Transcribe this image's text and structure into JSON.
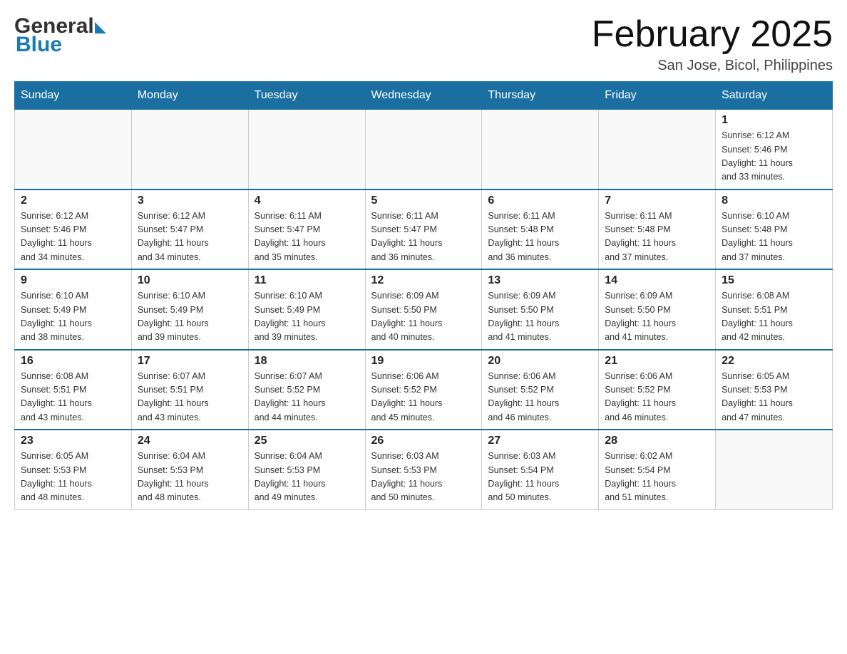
{
  "header": {
    "logo_general": "General",
    "logo_blue": "Blue",
    "month_title": "February 2025",
    "location": "San Jose, Bicol, Philippines"
  },
  "days_of_week": [
    "Sunday",
    "Monday",
    "Tuesday",
    "Wednesday",
    "Thursday",
    "Friday",
    "Saturday"
  ],
  "weeks": [
    {
      "days": [
        {
          "date": "",
          "info": ""
        },
        {
          "date": "",
          "info": ""
        },
        {
          "date": "",
          "info": ""
        },
        {
          "date": "",
          "info": ""
        },
        {
          "date": "",
          "info": ""
        },
        {
          "date": "",
          "info": ""
        },
        {
          "date": "1",
          "info": "Sunrise: 6:12 AM\nSunset: 5:46 PM\nDaylight: 11 hours\nand 33 minutes."
        }
      ]
    },
    {
      "days": [
        {
          "date": "2",
          "info": "Sunrise: 6:12 AM\nSunset: 5:46 PM\nDaylight: 11 hours\nand 34 minutes."
        },
        {
          "date": "3",
          "info": "Sunrise: 6:12 AM\nSunset: 5:47 PM\nDaylight: 11 hours\nand 34 minutes."
        },
        {
          "date": "4",
          "info": "Sunrise: 6:11 AM\nSunset: 5:47 PM\nDaylight: 11 hours\nand 35 minutes."
        },
        {
          "date": "5",
          "info": "Sunrise: 6:11 AM\nSunset: 5:47 PM\nDaylight: 11 hours\nand 36 minutes."
        },
        {
          "date": "6",
          "info": "Sunrise: 6:11 AM\nSunset: 5:48 PM\nDaylight: 11 hours\nand 36 minutes."
        },
        {
          "date": "7",
          "info": "Sunrise: 6:11 AM\nSunset: 5:48 PM\nDaylight: 11 hours\nand 37 minutes."
        },
        {
          "date": "8",
          "info": "Sunrise: 6:10 AM\nSunset: 5:48 PM\nDaylight: 11 hours\nand 37 minutes."
        }
      ]
    },
    {
      "days": [
        {
          "date": "9",
          "info": "Sunrise: 6:10 AM\nSunset: 5:49 PM\nDaylight: 11 hours\nand 38 minutes."
        },
        {
          "date": "10",
          "info": "Sunrise: 6:10 AM\nSunset: 5:49 PM\nDaylight: 11 hours\nand 39 minutes."
        },
        {
          "date": "11",
          "info": "Sunrise: 6:10 AM\nSunset: 5:49 PM\nDaylight: 11 hours\nand 39 minutes."
        },
        {
          "date": "12",
          "info": "Sunrise: 6:09 AM\nSunset: 5:50 PM\nDaylight: 11 hours\nand 40 minutes."
        },
        {
          "date": "13",
          "info": "Sunrise: 6:09 AM\nSunset: 5:50 PM\nDaylight: 11 hours\nand 41 minutes."
        },
        {
          "date": "14",
          "info": "Sunrise: 6:09 AM\nSunset: 5:50 PM\nDaylight: 11 hours\nand 41 minutes."
        },
        {
          "date": "15",
          "info": "Sunrise: 6:08 AM\nSunset: 5:51 PM\nDaylight: 11 hours\nand 42 minutes."
        }
      ]
    },
    {
      "days": [
        {
          "date": "16",
          "info": "Sunrise: 6:08 AM\nSunset: 5:51 PM\nDaylight: 11 hours\nand 43 minutes."
        },
        {
          "date": "17",
          "info": "Sunrise: 6:07 AM\nSunset: 5:51 PM\nDaylight: 11 hours\nand 43 minutes."
        },
        {
          "date": "18",
          "info": "Sunrise: 6:07 AM\nSunset: 5:52 PM\nDaylight: 11 hours\nand 44 minutes."
        },
        {
          "date": "19",
          "info": "Sunrise: 6:06 AM\nSunset: 5:52 PM\nDaylight: 11 hours\nand 45 minutes."
        },
        {
          "date": "20",
          "info": "Sunrise: 6:06 AM\nSunset: 5:52 PM\nDaylight: 11 hours\nand 46 minutes."
        },
        {
          "date": "21",
          "info": "Sunrise: 6:06 AM\nSunset: 5:52 PM\nDaylight: 11 hours\nand 46 minutes."
        },
        {
          "date": "22",
          "info": "Sunrise: 6:05 AM\nSunset: 5:53 PM\nDaylight: 11 hours\nand 47 minutes."
        }
      ]
    },
    {
      "days": [
        {
          "date": "23",
          "info": "Sunrise: 6:05 AM\nSunset: 5:53 PM\nDaylight: 11 hours\nand 48 minutes."
        },
        {
          "date": "24",
          "info": "Sunrise: 6:04 AM\nSunset: 5:53 PM\nDaylight: 11 hours\nand 48 minutes."
        },
        {
          "date": "25",
          "info": "Sunrise: 6:04 AM\nSunset: 5:53 PM\nDaylight: 11 hours\nand 49 minutes."
        },
        {
          "date": "26",
          "info": "Sunrise: 6:03 AM\nSunset: 5:53 PM\nDaylight: 11 hours\nand 50 minutes."
        },
        {
          "date": "27",
          "info": "Sunrise: 6:03 AM\nSunset: 5:54 PM\nDaylight: 11 hours\nand 50 minutes."
        },
        {
          "date": "28",
          "info": "Sunrise: 6:02 AM\nSunset: 5:54 PM\nDaylight: 11 hours\nand 51 minutes."
        },
        {
          "date": "",
          "info": ""
        }
      ]
    }
  ]
}
